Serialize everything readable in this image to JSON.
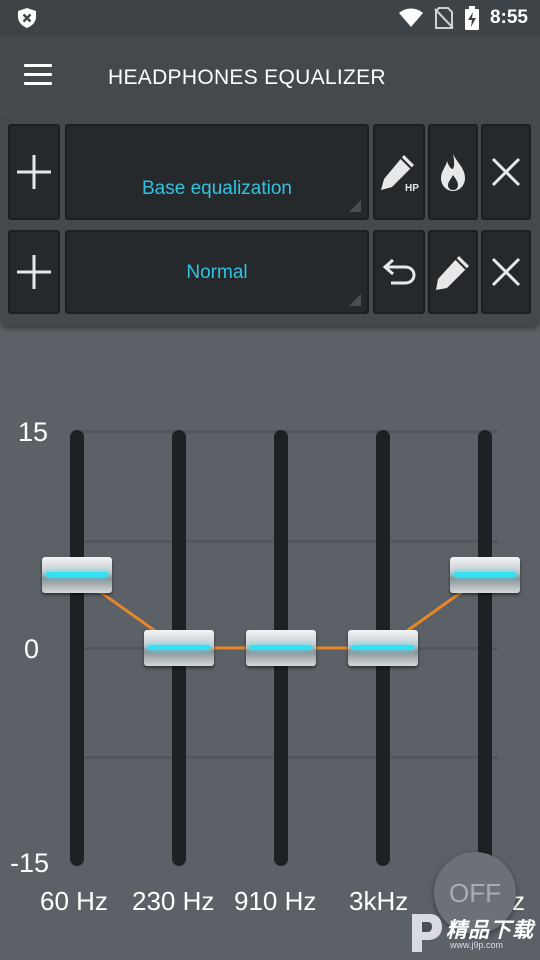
{
  "status_bar": {
    "time": "8:55",
    "icons": [
      "shield-close-icon",
      "wifi-icon",
      "no-sim-icon",
      "battery-charging-icon"
    ]
  },
  "app_bar": {
    "title": "HEADPHONES EQUALIZER",
    "menu_icon": "hamburger-menu-icon"
  },
  "preset_rows": [
    {
      "selected": "Base equalization",
      "buttons": [
        "add-icon",
        "pencil-hp-icon",
        "flame-icon",
        "close-icon"
      ]
    },
    {
      "selected": "Normal",
      "buttons": [
        "add-icon",
        "undo-icon",
        "pencil-icon",
        "close-icon"
      ]
    }
  ],
  "equalizer": {
    "scale": {
      "max": "15",
      "mid": "0",
      "min": "-15"
    },
    "bands": [
      {
        "label": "60 Hz",
        "gain": 5
      },
      {
        "label": "230 Hz",
        "gain": 0
      },
      {
        "label": "910 Hz",
        "gain": 0
      },
      {
        "label": "3kHz",
        "gain": 0
      },
      {
        "label": "z",
        "gain": 5
      }
    ],
    "range": [
      -15,
      15
    ],
    "curve_color": "#e8872a",
    "glow_color": "#35e0f2"
  },
  "power_button": {
    "label": "OFF"
  },
  "watermark": {
    "text": "精品下载",
    "sub": "www.j9p.com"
  }
}
